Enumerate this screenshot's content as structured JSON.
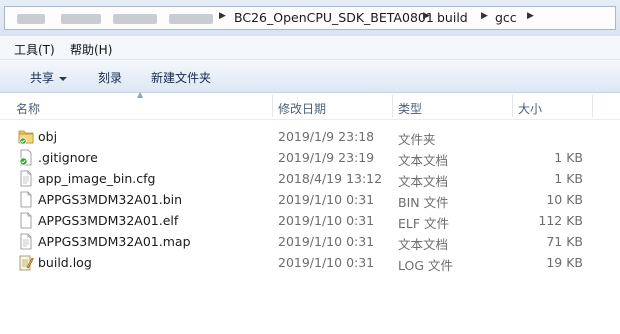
{
  "address": {
    "crumbs": [
      "BC26_OpenCPU_SDK_BETA0801",
      "build",
      "gcc"
    ]
  },
  "menu": {
    "tools": "工具(T)",
    "help": "帮助(H)"
  },
  "commands": {
    "share": "共享",
    "burn": "刻录",
    "new_folder": "新建文件夹"
  },
  "columns": {
    "name": "名称",
    "date": "修改日期",
    "type": "类型",
    "size": "大小"
  },
  "files": [
    {
      "name": "obj",
      "date": "2019/1/9 23:18",
      "type": "文件夹",
      "size": "",
      "icon": "folder-icon"
    },
    {
      "name": ".gitignore",
      "date": "2019/1/9 23:19",
      "type": "文本文档",
      "size": "1 KB",
      "icon": "git-document-icon"
    },
    {
      "name": "app_image_bin.cfg",
      "date": "2018/4/19 13:12",
      "type": "文本文档",
      "size": "1 KB",
      "icon": "document-icon"
    },
    {
      "name": "APPGS3MDM32A01.bin",
      "date": "2019/1/10 0:31",
      "type": "BIN 文件",
      "size": "10 KB",
      "icon": "document-icon"
    },
    {
      "name": "APPGS3MDM32A01.elf",
      "date": "2019/1/10 0:31",
      "type": "ELF 文件",
      "size": "112 KB",
      "icon": "document-icon"
    },
    {
      "name": "APPGS3MDM32A01.map",
      "date": "2019/1/10 0:31",
      "type": "文本文档",
      "size": "71 KB",
      "icon": "document-icon"
    },
    {
      "name": "build.log",
      "date": "2019/1/10 0:31",
      "type": "LOG 文件",
      "size": "19 KB",
      "icon": "log-document-icon"
    }
  ]
}
